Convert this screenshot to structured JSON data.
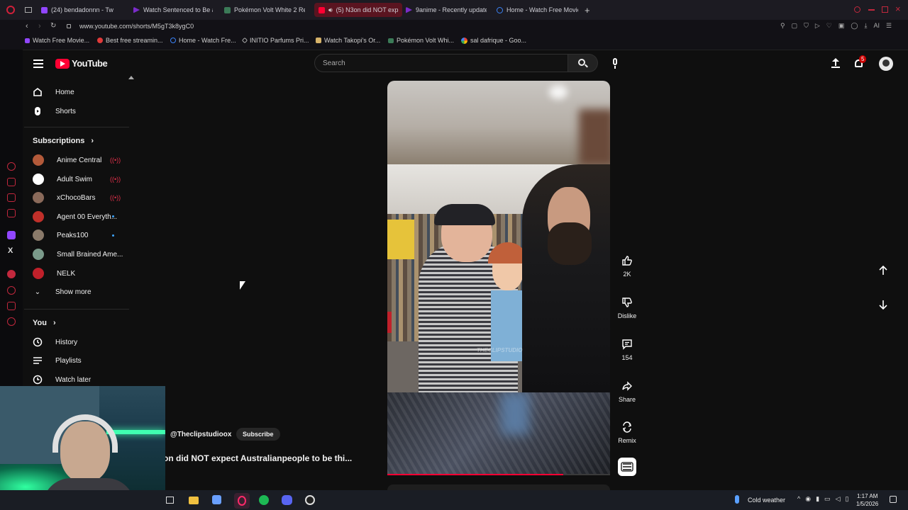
{
  "browser": {
    "tabs": [
      {
        "label": "(24) bendadonnn - Tw",
        "color": "#9146ff"
      },
      {
        "label": "Watch Sentenced to Be a",
        "color": "#7a2cc9"
      },
      {
        "label": "Pokémon Volt White 2 Re",
        "color": "#3b7a57"
      },
      {
        "label": "(5) N3on did NOT exp",
        "color": "#ff0033"
      },
      {
        "label": "9anime - Recently update",
        "color": "#7a2cc9"
      },
      {
        "label": "Home - Watch Free Movie",
        "color": "#3b82f6"
      }
    ],
    "url": "www.youtube.com/shorts/M5gT3k8ygC0",
    "bookmarks": [
      "Watch Free Movie...",
      "Best free streamin...",
      "Home - Watch Fre...",
      "INITIO Parfums Pri...",
      "Watch Takopi's Or...",
      "Pokémon Volt Whi...",
      "sal dafrique - Goo..."
    ]
  },
  "youtube": {
    "logo": "YouTube",
    "search_placeholder": "Search",
    "notification_count": "5",
    "sidebar": {
      "home": "Home",
      "shorts": "Shorts",
      "subscriptions_title": "Subscriptions",
      "subscriptions": [
        {
          "name": "Anime Central",
          "color": "#b35a3a"
        },
        {
          "name": "Adult Swim",
          "color": "#ffffff"
        },
        {
          "name": "xChocoBars",
          "color": "#8a6a5a"
        },
        {
          "name": "Agent 00 Everyth...",
          "color": "#c0302a"
        },
        {
          "name": "Peaks100",
          "color": "#8a7a6a"
        },
        {
          "name": "Small Brained Ame...",
          "color": "#7a9a8a"
        },
        {
          "name": "NELK",
          "color": "#c0202a"
        }
      ],
      "show_more": "Show more",
      "you_title": "You",
      "history": "History",
      "playlists": "Playlists",
      "watch_later": "Watch later"
    },
    "short": {
      "channel": "@Theclipstudioox",
      "subscribe": "Subscribe",
      "title": "on did NOT expect Australianpeople to be thi...",
      "watermark": "THECLIPSTUDIO",
      "progress": 0.79
    },
    "actions": {
      "like_count": "2K",
      "dislike": "Dislike",
      "comments": "154",
      "share": "Share",
      "remix": "Remix"
    }
  },
  "taskbar": {
    "weather": "Cold weather",
    "time": "1:17 AM",
    "date": "1/5/2026"
  }
}
